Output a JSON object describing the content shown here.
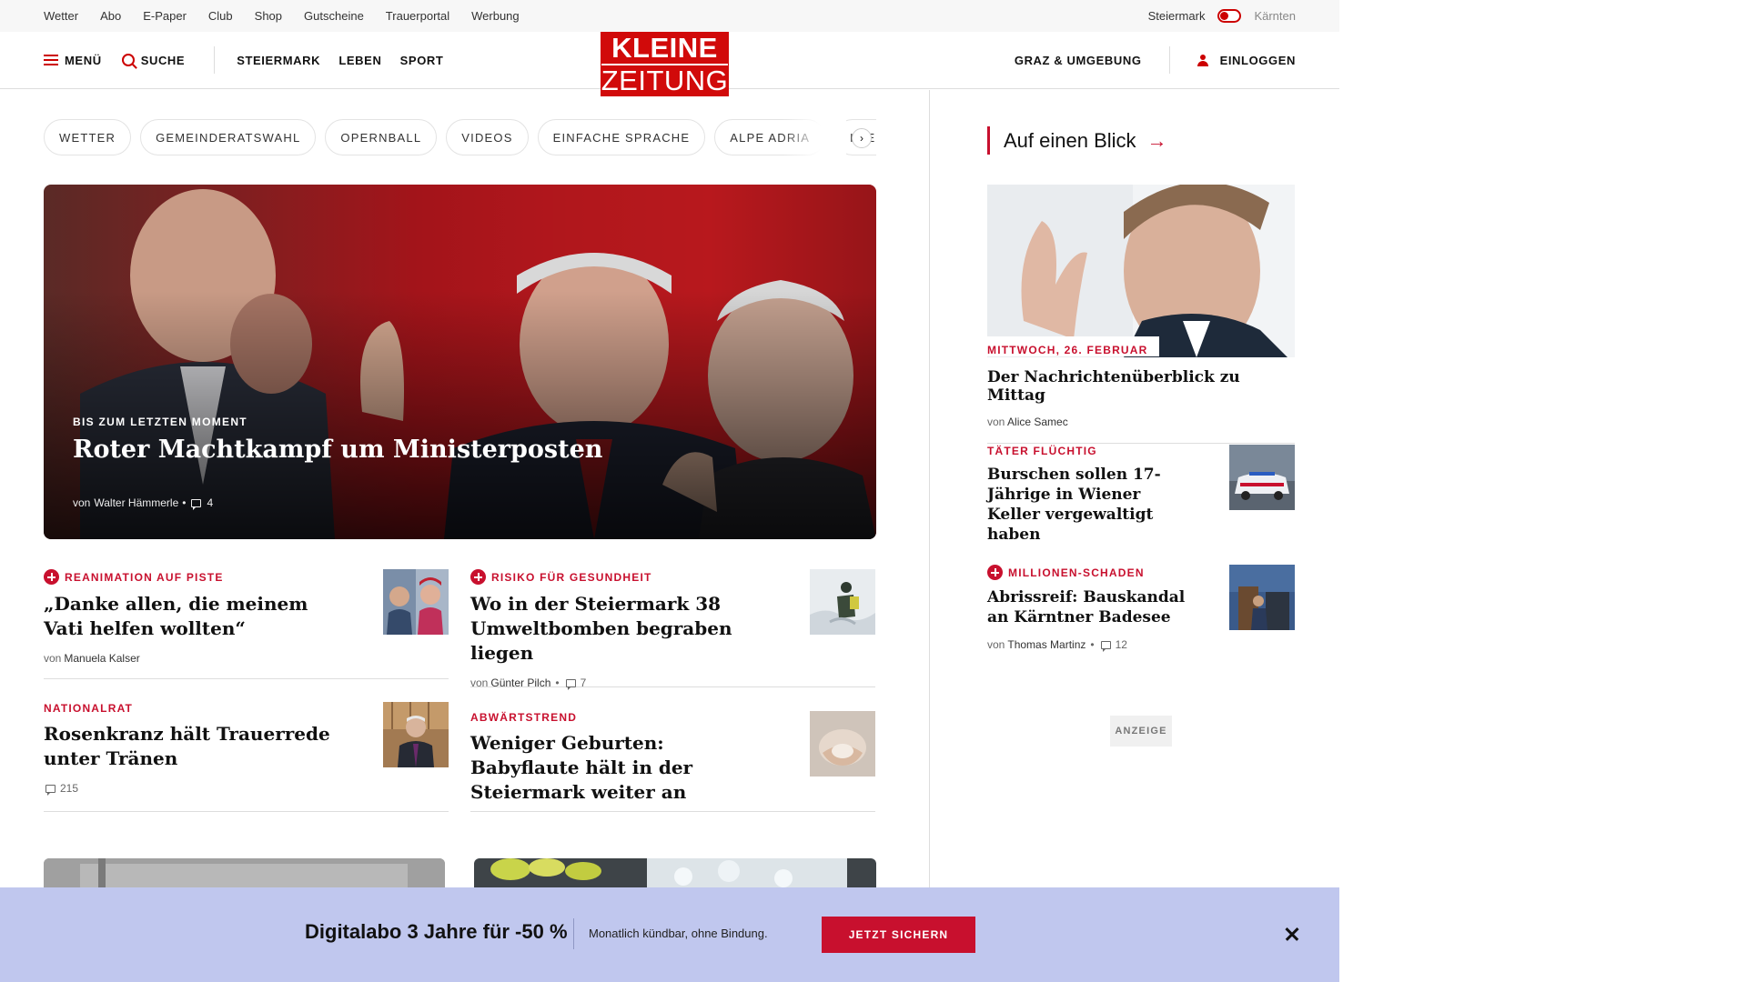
{
  "topbar": {
    "links": [
      "Wetter",
      "Abo",
      "E-Paper",
      "Club",
      "Shop",
      "Gutscheine",
      "Trauerportal",
      "Werbung"
    ],
    "region_active": "Steiermark",
    "region_other": "Kärnten"
  },
  "header": {
    "menu_label": "MENÜ",
    "search_label": "SUCHE",
    "nav": [
      "STEIERMARK",
      "LEBEN",
      "SPORT"
    ],
    "logo_line1": "KLEINE",
    "logo_line2": "ZEITUNG",
    "region_label": "GRAZ & UMGEBUNG",
    "login_label": "EINLOGGEN"
  },
  "chips": [
    "WETTER",
    "GEMEINDERATSWAHL",
    "OPERNBALL",
    "VIDEOS",
    "EINFACHE SPRACHE",
    "ALPE ADRIA",
    "KLEINE"
  ],
  "chips_next_label": "›",
  "hero": {
    "kicker": "BIS ZUM LETZTEN MOMENT",
    "title": "Roter Machtkampf um Ministerposten",
    "by": "von",
    "author": "Walter Hämmerle",
    "sep": "•",
    "comments": "4"
  },
  "articles": [
    {
      "kicker": "REANIMATION AUF PISTE",
      "title": "„Danke allen, die meinem Vati helfen wollten“",
      "by": "von",
      "author": "Manuela Kalser",
      "comments": ""
    },
    {
      "kicker": "RISIKO FÜR GESUNDHEIT",
      "title": "Wo in der Steiermark 38 Umweltbomben begraben liegen",
      "by": "von",
      "author": "Günter Pilch",
      "comments": "7"
    },
    {
      "kicker": "NATIONALRAT",
      "title": "Rosenkranz hält Trauerrede unter Tränen",
      "by": "",
      "author": "",
      "comments": "215"
    },
    {
      "kicker": "ABWÄRTSTREND",
      "title": "Weniger Geburten: Babyflaute hält in der Steiermark weiter an",
      "by": "",
      "author": "",
      "comments": ""
    }
  ],
  "sidebar": {
    "heading": "Auf einen Blick",
    "heading_arrow": "→",
    "top": {
      "date": "MITTWOCH, 26. FEBRUAR",
      "title": "Der Nachrichtenüberblick zu Mittag",
      "by": "von",
      "author": "Alice Samec"
    },
    "items": [
      {
        "kicker": "TÄTER FLÜCHTIG",
        "title": "Burschen sollen 17-Jährige in Wiener Keller vergewaltigt haben",
        "by": "",
        "author": "",
        "comments": ""
      },
      {
        "kicker": "MILLIONEN-SCHADEN",
        "title": "Abrissreif: Bauskandal an Kärntner Badesee",
        "by": "von",
        "author": "Thomas Martinz",
        "comments": "12"
      }
    ],
    "ad_label": "ANZEIGE"
  },
  "banner": {
    "headline": "Digitalabo 3 Jahre für -50 %",
    "sub": "Monatlich kündbar, ohne Bindung.",
    "cta": "JETZT SICHERN"
  },
  "colors": {
    "brand_red": "#d10a0a",
    "kicker_red": "#c8102e",
    "banner_bg": "#c0c7ee"
  }
}
